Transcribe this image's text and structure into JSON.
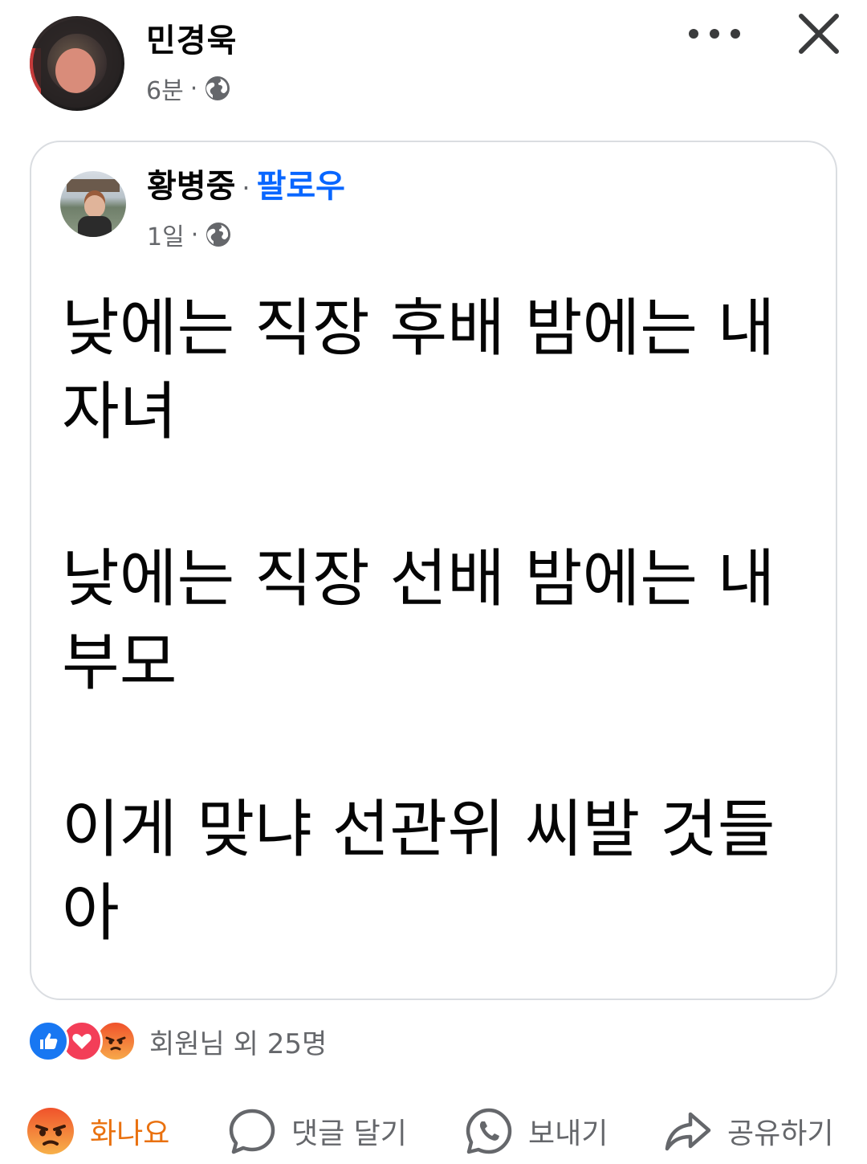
{
  "post": {
    "author": "민경욱",
    "time": "6분",
    "meta_sep": "·",
    "privacy_icon": "globe-icon"
  },
  "shared": {
    "author": "황병중",
    "sep": "·",
    "follow": "팔로우",
    "time": "1일",
    "meta_sep": "·",
    "paragraphs": [
      "낮에는 직장 후배 밤에는 내 자녀",
      "낮에는 직장 선배 밤에는 내 부모",
      "이게 맞냐 선관위 씨발 것들아"
    ]
  },
  "reactions": {
    "icons": [
      "like-icon",
      "love-icon",
      "angry-icon"
    ],
    "summary": "회원님 외 25명"
  },
  "actions": {
    "angry": "화나요",
    "comment": "댓글 달기",
    "send": "보내기",
    "share": "공유하기"
  },
  "colors": {
    "accent": "#0866ff",
    "angry": "#e9710f",
    "secondary_text": "#65676b",
    "like": "#1877f2",
    "love": "#f33e58"
  }
}
